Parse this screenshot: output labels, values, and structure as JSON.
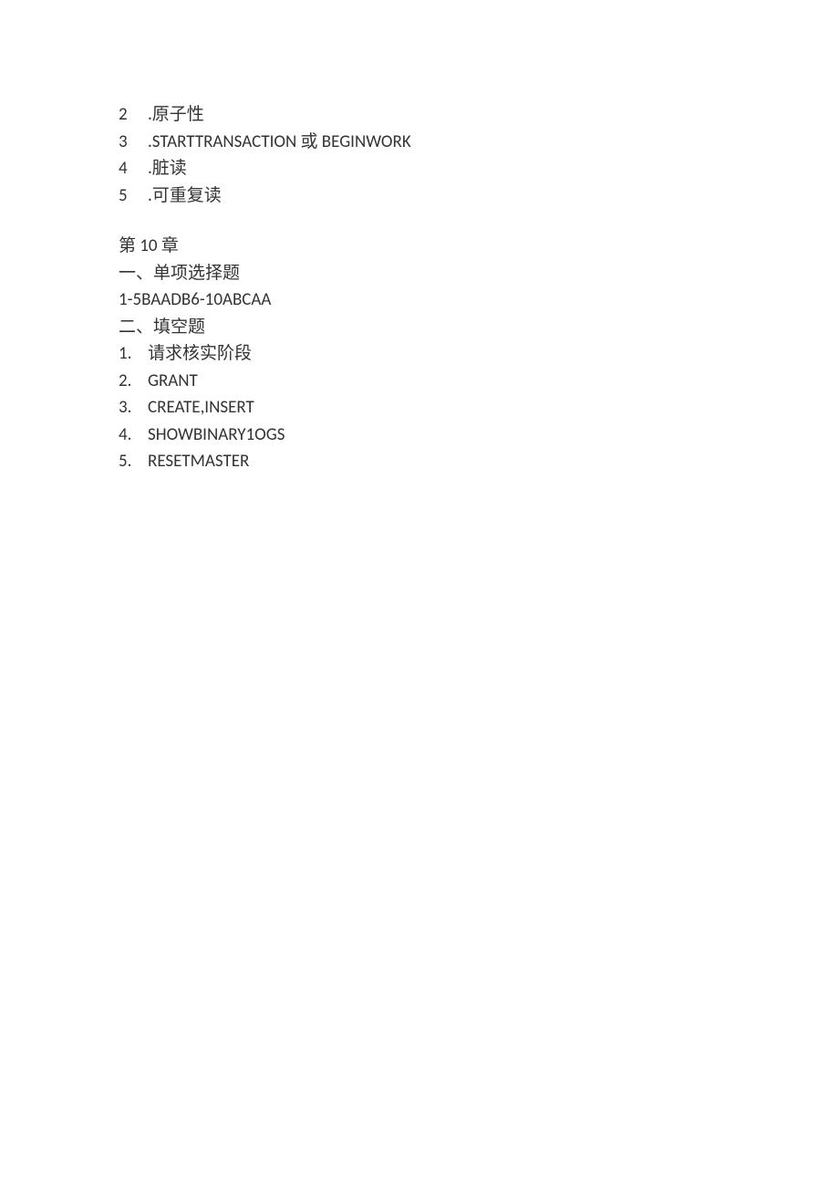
{
  "section_a": {
    "items": [
      {
        "num": "2",
        "text": ".原子性"
      },
      {
        "num": "3",
        "text": ".STARTTRANSACTION 或 BEGINWORK"
      },
      {
        "num": "4",
        "text": ".脏读"
      },
      {
        "num": "5",
        "text": ".可重复读"
      }
    ]
  },
  "chapter": {
    "title": "第 10 章",
    "part1_heading": "一、单项选择题",
    "part1_answer": "1-5BAADB6-10ABCAA",
    "part2_heading": "二、填空题",
    "part2_items": [
      {
        "num": "1.",
        "text": "请求核实阶段"
      },
      {
        "num": "2.",
        "text": "GRANT"
      },
      {
        "num": "3.",
        "text": "CREATE,INSERT"
      },
      {
        "num": "4.",
        "text": "SHOWBINARY1OGS"
      },
      {
        "num": "5.",
        "text": "RESETMASTER"
      }
    ]
  }
}
